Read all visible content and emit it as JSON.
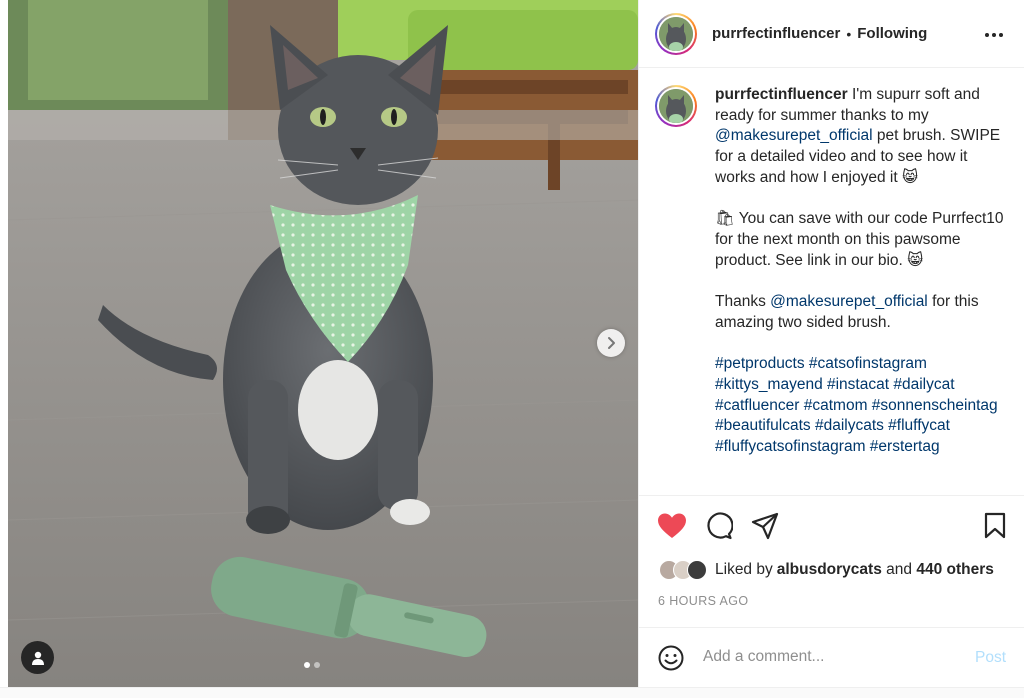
{
  "post": {
    "username": "purrfectinfluencer",
    "separator": "•",
    "follow_status": "Following",
    "more_icon": "more-horizontal-icon",
    "caption": {
      "username": "purrfectinfluencer",
      "line1": " I'm supurr soft and ready for summer thanks to my ",
      "mention1": "@makesurepet_official",
      "line2": " pet brush. SWIPE for a detailed video and to see how it works and how I enjoyed it 😸\n\n🛍 You can save with our code Purrfect10 for the next month on this pawsome product. See link in our bio. 😸\n\nThanks ",
      "mention2": "@makesurepet_official",
      "line3": " for this amazing two sided brush.\n\n",
      "hashtags": "#petproducts #catsofinstagram #kittys_mayend #instacat #dailycat #catfluencer #catmom #sonnenscheintag #beautifulcats #dailycats #fluffycat #fluffycatsofinstagram #erstertag"
    },
    "likes": {
      "prefix": "Liked by ",
      "user": "albusdorycats",
      "middle": " and ",
      "count_text": "440 others"
    },
    "timestamp": "6 HOURS AGO",
    "comment": {
      "placeholder": "Add a comment...",
      "post_label": "Post"
    },
    "carousel": {
      "slide_count": 2,
      "active_index": 0
    }
  },
  "colors": {
    "like_red": "#ed4956",
    "link_blue": "#00376b",
    "post_button_disabled": "#b2dffc",
    "muted_text": "#8e8e8e"
  },
  "icons": [
    "heart-icon",
    "comment-icon",
    "share-icon",
    "bookmark-icon",
    "emoji-icon",
    "chevron-right-icon",
    "user-tag-icon"
  ]
}
